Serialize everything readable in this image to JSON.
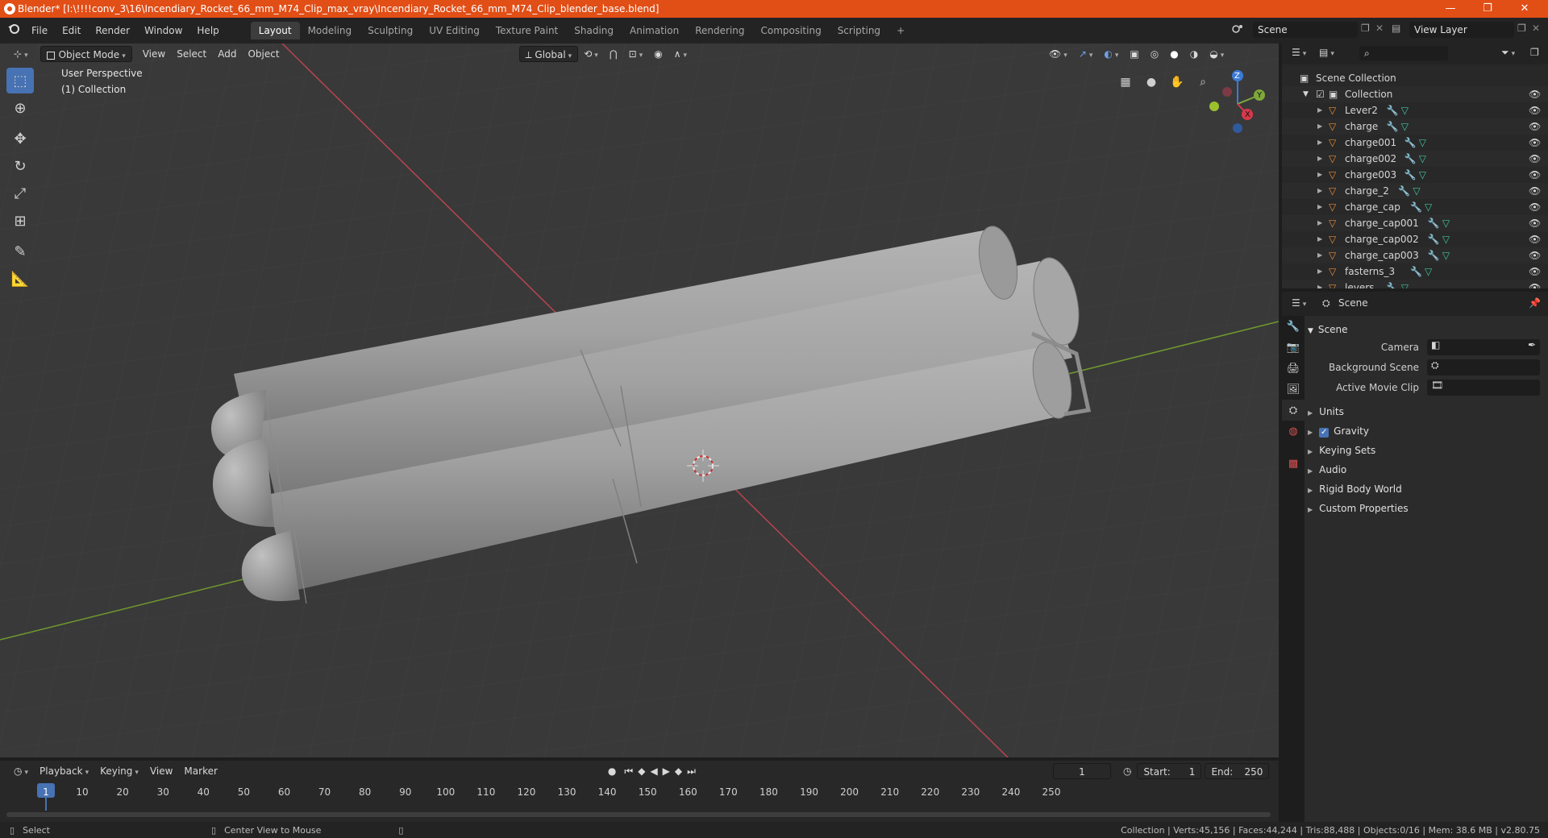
{
  "window": {
    "title": "Blender* [I:\\!!!!conv_3\\16\\Incendiary_Rocket_66_mm_M74_Clip_max_vray\\Incendiary_Rocket_66_mm_M74_Clip_blender_base.blend]",
    "minimize": "—",
    "maximize": "❐",
    "close": "✕"
  },
  "menu": [
    "File",
    "Edit",
    "Render",
    "Window",
    "Help"
  ],
  "workspaces": [
    "Layout",
    "Modeling",
    "Sculpting",
    "UV Editing",
    "Texture Paint",
    "Shading",
    "Animation",
    "Rendering",
    "Compositing",
    "Scripting"
  ],
  "add_workspace": "+",
  "scene_field": "Scene",
  "view_layer_field": "View Layer",
  "viewport": {
    "mode": "Object Mode",
    "menus": [
      "View",
      "Select",
      "Add",
      "Object"
    ],
    "transform_orientation": "Global",
    "overlay_text_1": "User Perspective",
    "overlay_text_2": "(1) Collection",
    "gizmo_x": "X",
    "gizmo_y": "Y",
    "gizmo_z": "Z"
  },
  "outliner": {
    "search_placeholder": "",
    "root": "Scene Collection",
    "collection": "Collection",
    "items": [
      "Lever2",
      "charge",
      "charge001",
      "charge002",
      "charge003",
      "charge_2",
      "charge_cap",
      "charge_cap001",
      "charge_cap002",
      "charge_cap003",
      "fasterns_3",
      "levers"
    ]
  },
  "properties": {
    "header": "Scene",
    "panel": "Scene",
    "camera_label": "Camera",
    "background_scene_label": "Background Scene",
    "active_movie_clip_label": "Active Movie Clip",
    "sections": [
      "Units",
      "Gravity",
      "Keying Sets",
      "Audio",
      "Rigid Body World",
      "Custom Properties"
    ],
    "gravity_checked": true
  },
  "timeline": {
    "menus": [
      "Playback",
      "Keying",
      "View",
      "Marker"
    ],
    "current_frame": "1",
    "start_label": "Start:",
    "start_value": "1",
    "end_label": "End:",
    "end_value": "250",
    "ticks": [
      "1",
      "10",
      "20",
      "30",
      "40",
      "50",
      "60",
      "70",
      "80",
      "90",
      "100",
      "110",
      "120",
      "130",
      "140",
      "150",
      "160",
      "170",
      "180",
      "190",
      "200",
      "210",
      "220",
      "230",
      "240",
      "250"
    ]
  },
  "status": {
    "left_action": "Select",
    "middle_action": "Center View to Mouse",
    "stats": "Collection | Verts:45,156 | Faces:44,244 | Tris:88,488 | Objects:0/16 | Mem: 38.6 MB | v2.80.75"
  },
  "colors": {
    "title_bar": "#e14e16",
    "accent_blue": "#4772b3",
    "object_orange": "#e98b3a",
    "mesh_green": "#3fc7a0",
    "axis_red": "#c2404e",
    "axis_green": "#7fa83a"
  }
}
